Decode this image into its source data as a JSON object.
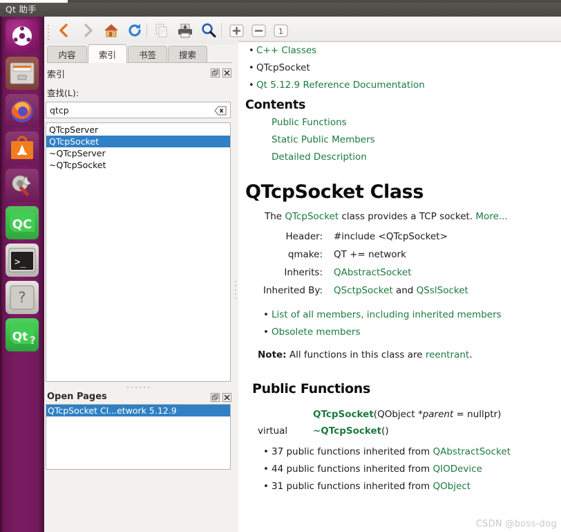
{
  "window": {
    "title": "Qt 助手"
  },
  "launcher": {
    "items": [
      {
        "name": "ubuntu-dash-icon",
        "label": "Ubuntu"
      },
      {
        "name": "files-icon",
        "label": "Files"
      },
      {
        "name": "firefox-icon",
        "label": "Firefox"
      },
      {
        "name": "software-center-icon",
        "label": "Ubuntu Software"
      },
      {
        "name": "system-settings-icon",
        "label": "System Settings"
      },
      {
        "name": "qt-creator-icon",
        "label": "QC"
      },
      {
        "name": "terminal-icon",
        "label": "Terminal"
      },
      {
        "name": "help-icon",
        "label": "?"
      },
      {
        "name": "qt-assistant-icon",
        "label": "Qt"
      }
    ]
  },
  "toolbar": {
    "buttons": [
      {
        "name": "back-button",
        "tooltip": "Back",
        "enabled": true
      },
      {
        "name": "forward-button",
        "tooltip": "Forward",
        "enabled": false
      },
      {
        "name": "home-button",
        "tooltip": "Home",
        "enabled": true
      },
      {
        "name": "reload-button",
        "tooltip": "Reload",
        "enabled": true
      },
      {
        "name": "copy-button",
        "tooltip": "Copy",
        "enabled": false
      },
      {
        "name": "print-button",
        "tooltip": "Print",
        "enabled": true
      },
      {
        "name": "find-button",
        "tooltip": "Find in Text",
        "enabled": true
      },
      {
        "name": "zoom-in-button",
        "tooltip": "Zoom In",
        "enabled": true
      },
      {
        "name": "zoom-out-button",
        "tooltip": "Zoom Out",
        "enabled": true
      },
      {
        "name": "reset-zoom-button",
        "tooltip": "Normal Size",
        "label": "1",
        "enabled": true
      }
    ]
  },
  "tabs": [
    {
      "label": "内容",
      "active": false
    },
    {
      "label": "索引",
      "active": true
    },
    {
      "label": "书签",
      "active": false
    },
    {
      "label": "搜索",
      "active": false
    }
  ],
  "index_dock": {
    "title": "索引",
    "lookfor_label": "查找(L):",
    "search_value": "qtcp",
    "search_placeholder": "",
    "items": [
      {
        "label": "QTcpServer",
        "selected": false
      },
      {
        "label": "QTcpSocket",
        "selected": true
      },
      {
        "label": "~QTcpServer",
        "selected": false
      },
      {
        "label": "~QTcpSocket",
        "selected": false
      }
    ]
  },
  "open_pages": {
    "title": "Open Pages",
    "items": [
      {
        "label": "QTcpSocket Cl...etwork 5.12.9",
        "selected": true
      }
    ]
  },
  "document": {
    "breadcrumbs": [
      {
        "text": "C++ Classes",
        "link": true
      },
      {
        "text": "QTcpSocket",
        "link": false
      },
      {
        "text": "Qt 5.12.9 Reference Documentation",
        "link": true
      }
    ],
    "contents_heading": "Contents",
    "contents_links": [
      "Public Functions",
      "Static Public Members",
      "Detailed Description"
    ],
    "class_title": "QTcpSocket Class",
    "description": {
      "prefix": "The ",
      "class_link": "QTcpSocket",
      "suffix": " class provides a TCP socket. ",
      "more_link": "More..."
    },
    "info_rows": [
      {
        "key": "Header:",
        "value": "#include <QTcpSocket>",
        "link": false
      },
      {
        "key": "qmake:",
        "value": "QT += network",
        "link": false
      },
      {
        "key": "Inherits:",
        "value": "QAbstractSocket",
        "link": true
      },
      {
        "key": "Inherited By:",
        "value_links": [
          "QSctpSocket",
          "QSslSocket"
        ],
        "joiner": " and "
      }
    ],
    "member_links": [
      "List of all members, including inherited members",
      "Obsolete members"
    ],
    "note": {
      "label": "Note:",
      "text": " All functions in this class are ",
      "link": "reentrant",
      "tail": "."
    },
    "public_functions_heading": "Public Functions",
    "functions": [
      {
        "modifier": "",
        "name": "QTcpSocket",
        "args_pre": "(QObject *",
        "param": "parent",
        "args_post": " = nullptr)"
      },
      {
        "modifier": "virtual",
        "name": "~QTcpSocket",
        "args_pre": "(",
        "param": "",
        "args_post": ")"
      }
    ],
    "inherited_notes": [
      {
        "count": "37",
        "text": " public functions inherited from ",
        "link": "QAbstractSocket"
      },
      {
        "count": "44",
        "text": " public functions inherited from ",
        "link": "QIODevice"
      },
      {
        "count": "31",
        "text": " public functions inherited from ",
        "link": "QObject"
      }
    ]
  },
  "watermark": {
    "text": "CSDN @boss-dog"
  },
  "colors": {
    "link_green": "#1b7a3e",
    "selection_blue": "#2f80c4",
    "launcher_purple": "#7b1c63",
    "titlebar_grey": "#4b4a45"
  }
}
